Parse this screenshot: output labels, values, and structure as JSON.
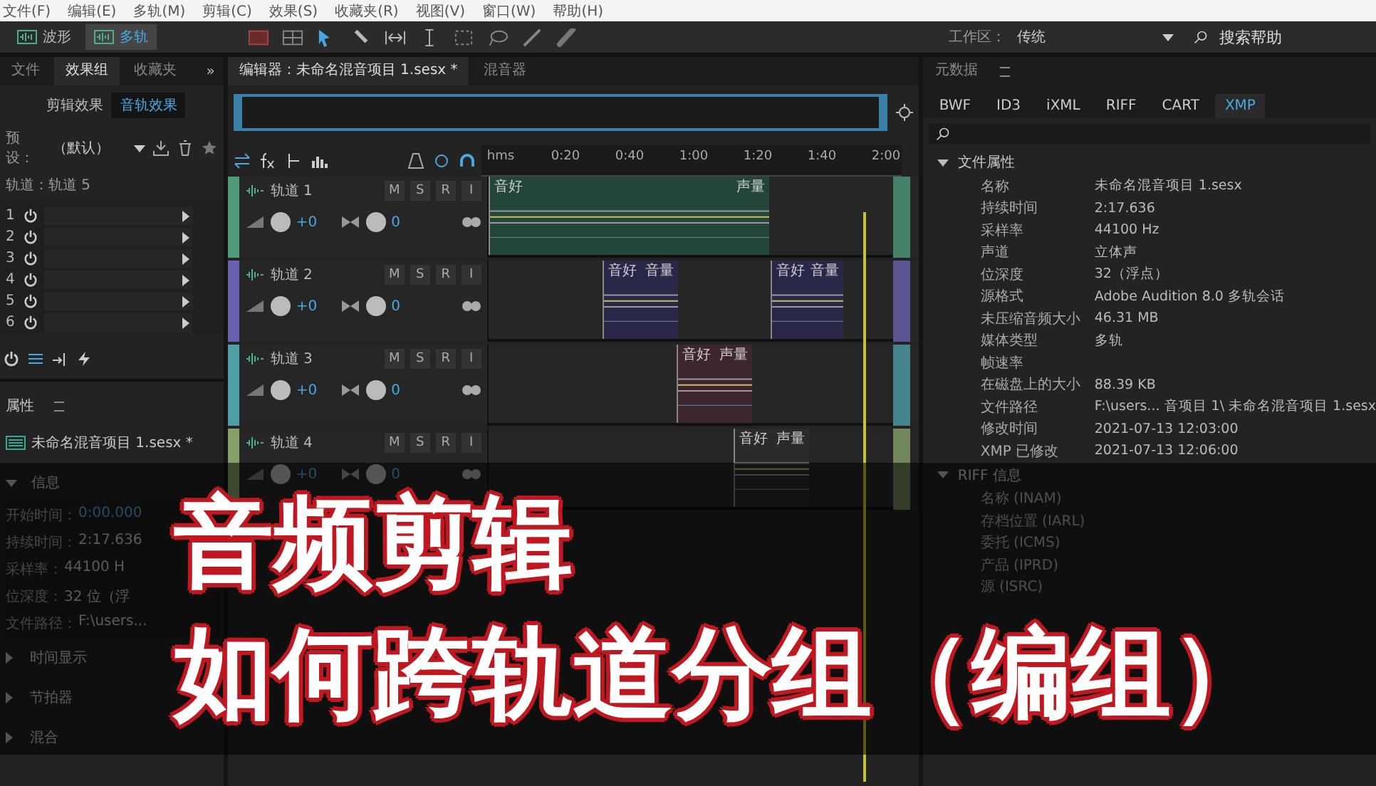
{
  "menu": [
    "文件(F)",
    "编辑(E)",
    "多轨(M)",
    "剪辑(C)",
    "效果(S)",
    "收藏夹(R)",
    "视图(V)",
    "窗口(W)",
    "帮助(H)"
  ],
  "view_toggle": [
    {
      "label": "波形",
      "selected": false
    },
    {
      "label": "多轨",
      "selected": true
    }
  ],
  "workspace": {
    "label": "工作区：",
    "value": "传统"
  },
  "help_search": {
    "placeholder": "搜索帮助"
  },
  "left_tabs": [
    {
      "label": "文件",
      "selected": false
    },
    {
      "label": "效果组",
      "selected": true
    },
    {
      "label": "收藏夹",
      "selected": false
    }
  ],
  "overflow": "»",
  "effect_tabs": [
    {
      "label": "剪辑效果",
      "selected": false
    },
    {
      "label": "音轨效果",
      "selected": true
    }
  ],
  "preset": {
    "label": "预设：",
    "value": "（默认）"
  },
  "track_label": "轨道：轨道 5",
  "rack_slots": [
    "1",
    "2",
    "3",
    "4",
    "5",
    "6"
  ],
  "properties": {
    "title": "属性",
    "file": "未命名混音项目 1.sesx *",
    "section": "信息",
    "expanded": true,
    "rows": [
      {
        "label": "开始时间：",
        "value": "0:00.000"
      },
      {
        "label": "持续时间：",
        "value": "2:17.636"
      },
      {
        "label": "采样率：",
        "value": "44100 H"
      },
      {
        "label": "位深度：",
        "value": "32 位（浮"
      },
      {
        "label": "文件路径：",
        "value": "F:\\users..."
      }
    ],
    "sections": [
      "时间显示",
      "节拍器",
      "混合"
    ]
  },
  "editor": {
    "tabs": [
      {
        "label": "编辑器：未命名混音项目 1.sesx *",
        "selected": true
      },
      {
        "label": "混音器",
        "selected": false
      }
    ],
    "ruler": [
      "hms",
      "0:20",
      "0:40",
      "1:00",
      "1:20",
      "1:40",
      "2:00"
    ],
    "tracks": [
      {
        "name": "轨道 1",
        "color": "#4f9a78",
        "volume": "+0",
        "pan": "0",
        "buttons": [
          "M",
          "S",
          "R",
          "I"
        ],
        "clips": [
          {
            "labels": [
              "音好",
              "声量"
            ]
          }
        ]
      },
      {
        "name": "轨道 2",
        "color": "#6a62b0",
        "volume": "+0",
        "pan": "0",
        "buttons": [
          "M",
          "S",
          "R",
          "I"
        ],
        "clips": [
          {
            "labels": [
              "音好",
              "音量"
            ]
          },
          {
            "labels": [
              "音好",
              "音量"
            ]
          }
        ]
      },
      {
        "name": "轨道 3",
        "color": "#4f9ea6",
        "volume": "+0",
        "pan": "0",
        "buttons": [
          "M",
          "S",
          "R",
          "I"
        ],
        "clips": [
          {
            "labels": [
              "音好",
              "声量"
            ]
          }
        ]
      },
      {
        "name": "轨道 4",
        "color": "#86a06a",
        "volume": "+0",
        "pan": "0",
        "buttons": [
          "M",
          "S",
          "R",
          "I"
        ],
        "clips": [
          {
            "labels": [
              "音好",
              "声量"
            ]
          }
        ]
      }
    ]
  },
  "metadata": {
    "title": "元数据",
    "tabs": [
      {
        "label": "BWF",
        "selected": false
      },
      {
        "label": "ID3",
        "selected": false
      },
      {
        "label": "iXML",
        "selected": false
      },
      {
        "label": "RIFF",
        "selected": false
      },
      {
        "label": "CART",
        "selected": false
      },
      {
        "label": "XMP",
        "selected": true
      }
    ],
    "sections": [
      {
        "title": "文件属性",
        "expanded": true,
        "rows": [
          {
            "label": "名称",
            "value": "未命名混音项目 1.sesx"
          },
          {
            "label": "持续时间",
            "value": "2:17.636"
          },
          {
            "label": "采样率",
            "value": "44100 Hz"
          },
          {
            "label": "声道",
            "value": "立体声"
          },
          {
            "label": "位深度",
            "value": "32（浮点）"
          },
          {
            "label": "源格式",
            "value": "Adobe Audition 8.0 多轨会话"
          },
          {
            "label": "未压缩音频大小",
            "value": "46.31 MB"
          },
          {
            "label": "媒体类型",
            "value": "多轨"
          },
          {
            "label": "帧速率"
          },
          {
            "label": "在磁盘上的大小",
            "value": "88.39 KB"
          },
          {
            "label": "文件路径",
            "value": "F:\\users... 音项目 1\\ 未命名混音项目 1.sesx"
          },
          {
            "label": "修改时间",
            "value": "2021-07-13 12:03:00"
          },
          {
            "label": "XMP 已修改",
            "value": "2021-07-13 12:06:00"
          }
        ]
      },
      {
        "title": "RIFF 信息",
        "expanded": true,
        "rows": [
          {
            "label": "名称 (INAM)"
          },
          {
            "label": "存档位置 (IARL)"
          },
          {
            "label": "委托 (ICMS)"
          },
          {
            "label": "产品 (IPRD)"
          },
          {
            "label": "源 (ISRC)"
          }
        ]
      }
    ]
  },
  "overlay": {
    "lines": [
      "音频剪辑",
      "如何跨轨道分组（编组）"
    ]
  }
}
